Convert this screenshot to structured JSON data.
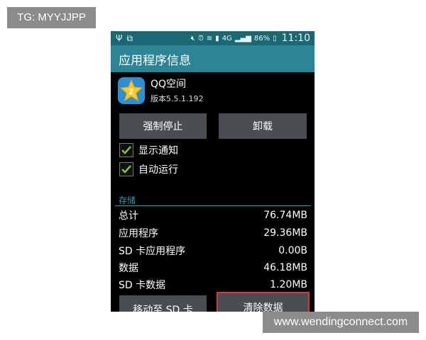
{
  "watermarks": {
    "top": "TG: MYYJJPP",
    "bottom": "www.wendingconnect.com"
  },
  "statusbar": {
    "network": "4G",
    "battery": "86%",
    "time": "11:10"
  },
  "header": {
    "title": "应用程序信息"
  },
  "app": {
    "name": "QQ空间",
    "version": "版本5.5.1.192",
    "icon": "qzone-star-icon"
  },
  "buttons": {
    "force_stop": "强制停止",
    "uninstall": "卸载",
    "move_to_sd": "移动至 SD 卡",
    "clear_data": "清除数据"
  },
  "checkboxes": [
    {
      "label": "显示通知",
      "checked": true
    },
    {
      "label": "自动运行",
      "checked": true
    }
  ],
  "storage": {
    "section_label": "存储",
    "rows": [
      {
        "label": "总计",
        "value": "76.74MB"
      },
      {
        "label": "应用程序",
        "value": "29.36MB"
      },
      {
        "label": "SD 卡应用程序",
        "value": "0.00B"
      },
      {
        "label": "数据",
        "value": "46.18MB"
      },
      {
        "label": "SD 卡数据",
        "value": "1.20MB"
      }
    ]
  },
  "colors": {
    "titlebar": "#2d8494",
    "statusbar": "#1a6874",
    "accent": "#2f9bb0",
    "check": "#7fc241",
    "highlight": "#d43a3a"
  }
}
